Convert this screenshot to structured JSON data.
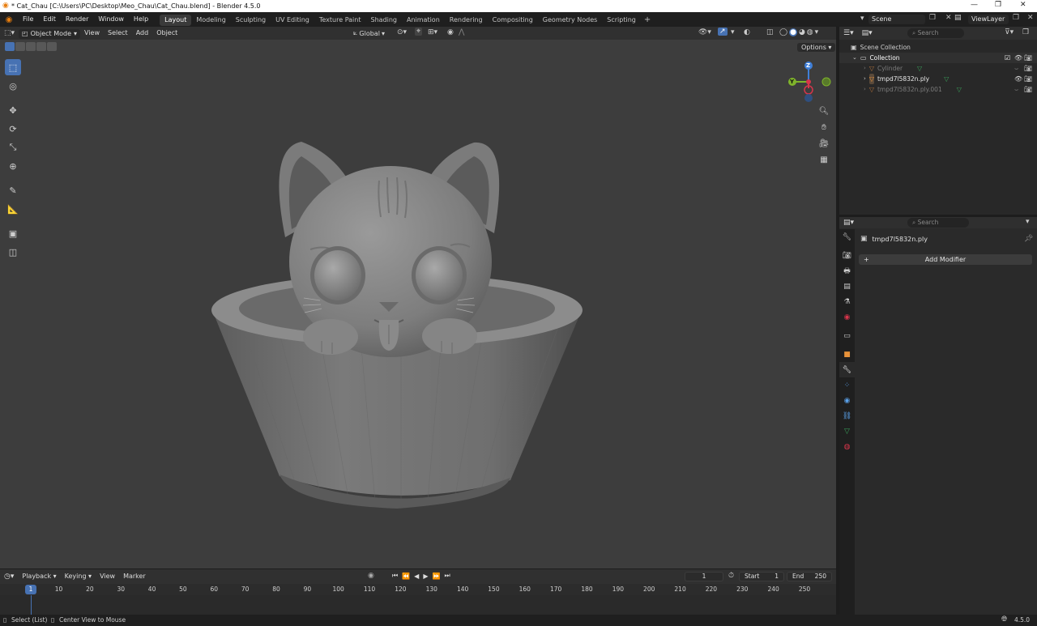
{
  "window": {
    "title": "* Cat_Chau [C:\\Users\\PC\\Desktop\\Meo_Chau\\Cat_Chau.blend] - Blender 4.5.0",
    "minimize": "—",
    "maximize": "❐",
    "close": "✕"
  },
  "menu": [
    "File",
    "Edit",
    "Render",
    "Window",
    "Help"
  ],
  "workspaces": [
    "Layout",
    "Modeling",
    "Sculpting",
    "UV Editing",
    "Texture Paint",
    "Shading",
    "Animation",
    "Rendering",
    "Compositing",
    "Geometry Nodes",
    "Scripting"
  ],
  "active_workspace": "Layout",
  "scene": {
    "label": "Scene",
    "view_layer": "ViewLayer"
  },
  "viewport": {
    "mode": "Object Mode",
    "menus": [
      "View",
      "Select",
      "Add",
      "Object"
    ],
    "orientation": "Global",
    "options": "Options",
    "gizmo": {
      "z": "Z",
      "y": "Y"
    }
  },
  "outliner": {
    "search_placeholder": "Search",
    "root": "Scene Collection",
    "collection": "Collection",
    "items": [
      "Cylinder",
      "tmpd7l5832n.ply",
      "tmpd7l5832n.ply.001"
    ]
  },
  "properties": {
    "search_placeholder": "Search",
    "object_name": "tmpd7l5832n.ply",
    "add_modifier": "Add Modifier"
  },
  "timeline": {
    "menus": [
      "Playback",
      "Keying",
      "View",
      "Marker"
    ],
    "current_frame": "1",
    "start_label": "Start",
    "start": "1",
    "end_label": "End",
    "end": "250",
    "ticks": [
      "1",
      "10",
      "20",
      "30",
      "40",
      "50",
      "60",
      "70",
      "80",
      "90",
      "100",
      "110",
      "120",
      "130",
      "140",
      "150",
      "160",
      "170",
      "180",
      "190",
      "200",
      "210",
      "220",
      "230",
      "240",
      "250"
    ]
  },
  "status": {
    "left": "Select (List)",
    "middle": "Center View to Mouse",
    "version": "4.5.0"
  },
  "colors": {
    "accent": "#4772b3",
    "viewport_bg": "#3d3d3d",
    "panel_bg": "#2a2a2a",
    "gizmo_x": "#d7354b",
    "gizmo_y": "#7fb32b",
    "gizmo_z": "#3f7fd8"
  }
}
